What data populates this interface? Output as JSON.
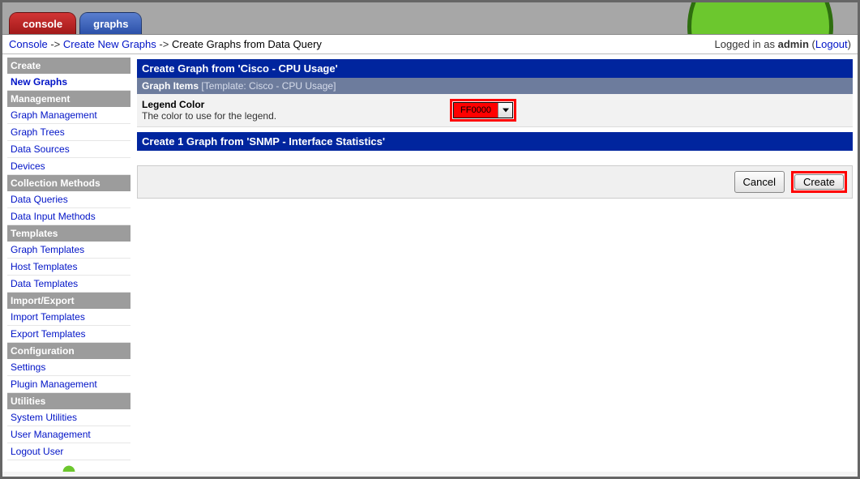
{
  "tabs": {
    "console": "console",
    "graphs": "graphs"
  },
  "breadcrumb": {
    "a": "Console",
    "b": "Create New Graphs",
    "c": "Create Graphs from Data Query"
  },
  "login": {
    "prefix": "Logged in as ",
    "user": "admin",
    "logout": "Logout"
  },
  "sidebar": {
    "create": {
      "head": "Create",
      "newGraphs": "New Graphs"
    },
    "management": {
      "head": "Management",
      "graphMgmt": "Graph Management",
      "graphTrees": "Graph Trees",
      "dataSources": "Data Sources",
      "devices": "Devices"
    },
    "collection": {
      "head": "Collection Methods",
      "dataQueries": "Data Queries",
      "dataInput": "Data Input Methods"
    },
    "templates": {
      "head": "Templates",
      "graphT": "Graph Templates",
      "hostT": "Host Templates",
      "dataT": "Data Templates"
    },
    "impexp": {
      "head": "Import/Export",
      "imp": "Import Templates",
      "exp": "Export Templates"
    },
    "config": {
      "head": "Configuration",
      "settings": "Settings",
      "plugin": "Plugin Management"
    },
    "utils": {
      "head": "Utilities",
      "sys": "System Utilities",
      "usermgmt": "User Management",
      "logout": "Logout User"
    }
  },
  "content": {
    "title1": "Create Graph from 'Cisco - CPU Usage'",
    "subtitle1a": "Graph Items ",
    "subtitle1b": "[Template: Cisco - CPU Usage]",
    "legend": {
      "label": "Legend Color",
      "desc": "The color to use for the legend.",
      "value": "FF0000"
    },
    "title2": "Create 1 Graph from 'SNMP - Interface Statistics'",
    "buttons": {
      "cancel": "Cancel",
      "create": "Create"
    }
  }
}
